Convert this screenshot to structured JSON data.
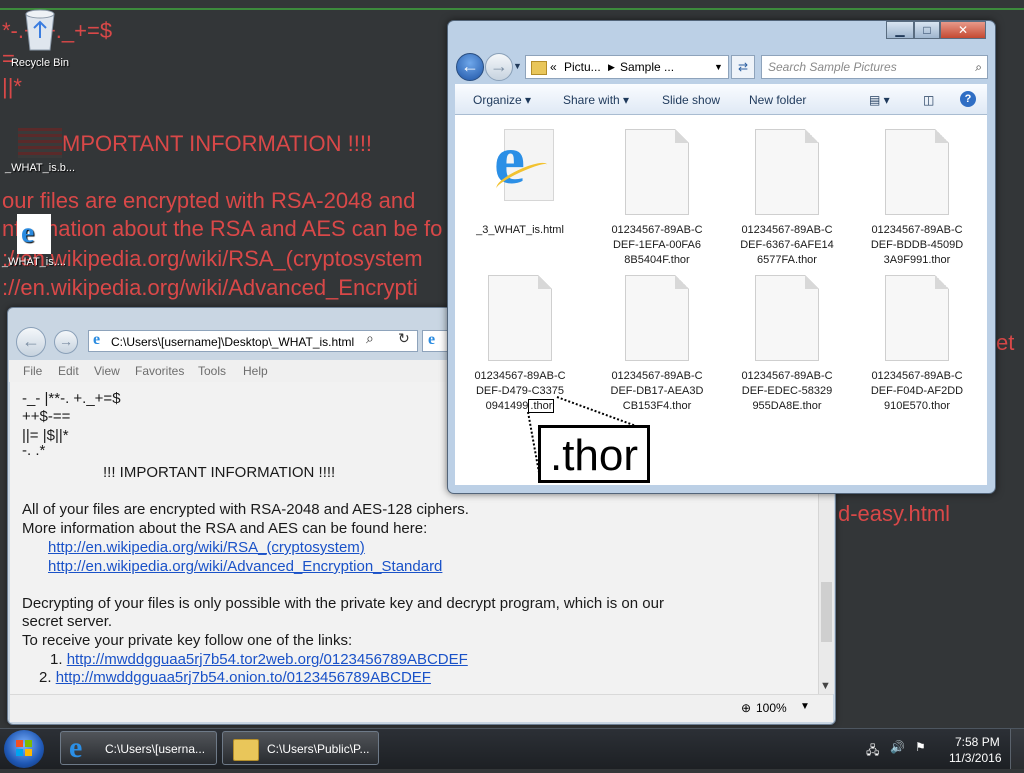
{
  "desktop": {
    "wallpaper_lines": [
      "*-.+.+._+=$",
      "=",
      "||*",
      "MPORTANT INFORMATION !!!!",
      "our files are encrypted with RSA-2048 and",
      "nformation about the RSA and AES can be fo",
      "://en.wikipedia.org/wiki/RSA_(cryptosystem",
      "://en.wikipedia.org/wiki/Advanced_Encrypti",
      "et",
      "d-easy.html"
    ],
    "icons": [
      {
        "label": "Recycle Bin",
        "icon": "recycle-bin-icon"
      },
      {
        "label": "_WHAT_is.b...",
        "icon": "bmp-file-icon"
      },
      {
        "label": "_WHAT_is....",
        "icon": "ie-html-file-icon"
      }
    ]
  },
  "ie": {
    "address": "C:\\Users\\[username]\\Desktop\\_WHAT_is.html",
    "menu": [
      "File",
      "Edit",
      "View",
      "Favorites",
      "Tools",
      "Help"
    ],
    "content": {
      "header_lines": [
        "-_-  |**-. +._+=$",
        "++$-==",
        "||= |$||*",
        "-.  .*"
      ],
      "title": "!!!  IMPORTANT INFORMATION !!!!",
      "p1_line1": "All  of your files are  encrypted  with RSA-2048 and AES-128  ciphers.",
      "p1_line2": "More information about  the RSA and  AES can be  found here:",
      "link_rsa": "http://en.wikipedia.org/wiki/RSA_(cryptosystem)",
      "link_aes": "http://en.wikipedia.org/wiki/Advanced_Encryption_Standard",
      "p2_line1": "Decrypting of  your files is  only  possible with the private key and decrypt program, which  is on our",
      "p2_line2": "secret  server.",
      "p2_line3": "To  receive  your private  key  follow  one  of  the links:",
      "links": [
        {
          "num": "1.",
          "url": "http://mwddgguaa5rj7b54.tor2web.org/0123456789ABCDEF"
        },
        {
          "num": "2.",
          "url": "http://mwddgguaa5rj7b54.onion.to/0123456789ABCDEF"
        }
      ]
    },
    "zoom": "100%"
  },
  "explorer": {
    "breadcrumb": [
      "«",
      "Pictu...",
      "Sample ..."
    ],
    "search_placeholder": "Search Sample Pictures",
    "commands": [
      "Organize",
      "Share with",
      "Slide show",
      "New folder"
    ],
    "files": [
      {
        "name": "_3_WHAT_is.html",
        "icon": "ie-html-file-icon"
      },
      {
        "name": "01234567-89AB-C\nDEF-1EFA-00FA6\n8B5404F.thor",
        "icon": "blank-file-icon"
      },
      {
        "name": "01234567-89AB-C\nDEF-6367-6AFE14\n6577FA.thor",
        "icon": "blank-file-icon"
      },
      {
        "name": "01234567-89AB-C\nDEF-BDDB-4509D\n3A9F991.thor",
        "icon": "blank-file-icon"
      },
      {
        "name_main": "01234567-89AB-C\nDEF-D479-C3375\n0941499",
        "ext": ".thor",
        "icon": "blank-file-icon"
      },
      {
        "name": "01234567-89AB-C\nDEF-DB17-AEA3D\nCB153F4.thor",
        "icon": "blank-file-icon"
      },
      {
        "name": "01234567-89AB-C\nDEF-EDEC-58329\n955DA8E.thor",
        "icon": "blank-file-icon"
      },
      {
        "name": "01234567-89AB-C\nDEF-F04D-AF2DD\n910E570.thor",
        "icon": "blank-file-icon"
      }
    ],
    "callout": ".thor"
  },
  "taskbar": {
    "tasks": [
      {
        "label": "C:\\Users\\[userna...",
        "icon": "ie-icon"
      },
      {
        "label": "C:\\Users\\Public\\P...",
        "icon": "folder-icon"
      }
    ],
    "time": "7:58 PM",
    "date": "11/3/2016"
  }
}
